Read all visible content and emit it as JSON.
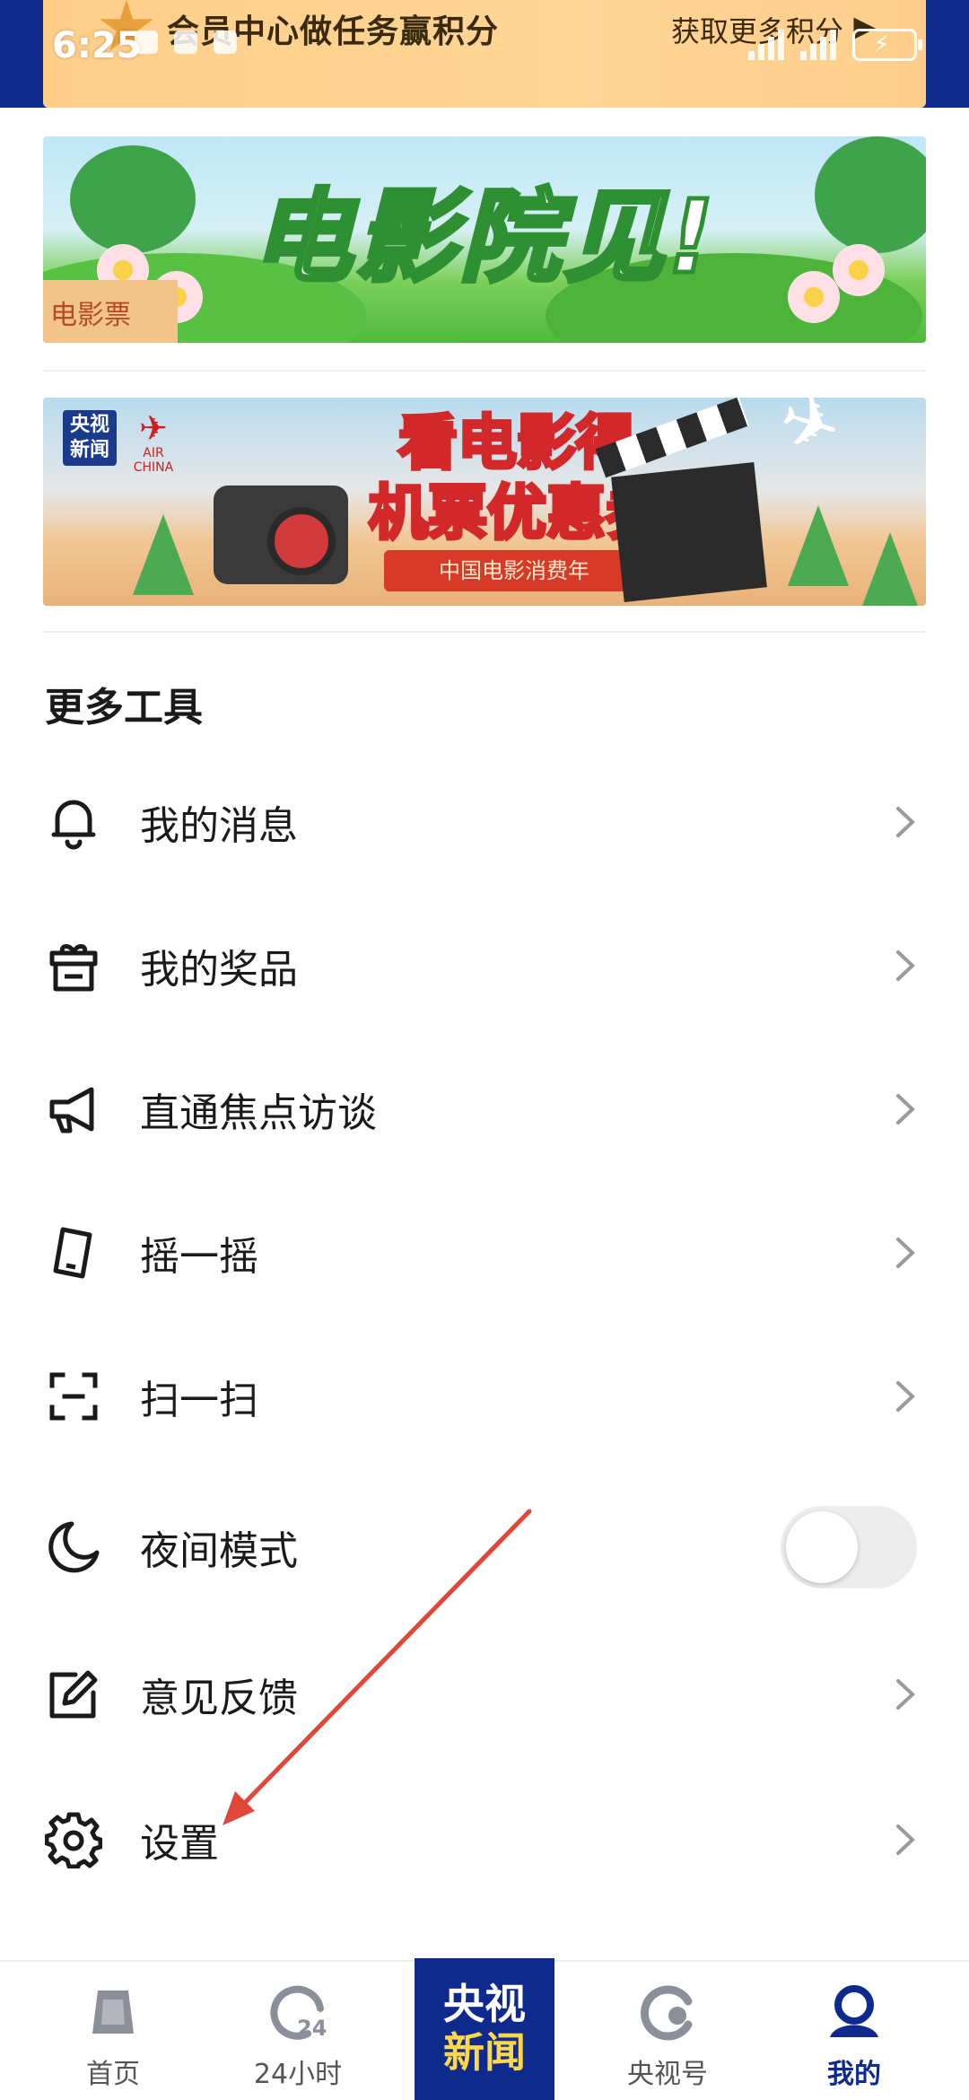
{
  "status_bar": {
    "time": "6:25"
  },
  "task_banner": {
    "title": "会员中心做任务赢积分",
    "link": "获取更多积分",
    "arrow": "▶"
  },
  "banners": {
    "movie": {
      "title": "电影院见!",
      "ticket": "电影票"
    },
    "airchina": {
      "badge": "央视\n新闻",
      "brand": "AIR CHINA",
      "headline_1": "看电影得",
      "headline_2": "机票优惠券",
      "ribbon": "中国电影消费年"
    }
  },
  "section": {
    "title": "更多工具"
  },
  "menu": [
    {
      "label": "我的消息",
      "icon": "bell-icon",
      "control": "chevron"
    },
    {
      "label": "我的奖品",
      "icon": "gift-icon",
      "control": "chevron"
    },
    {
      "label": "直通焦点访谈",
      "icon": "megaphone-icon",
      "control": "chevron"
    },
    {
      "label": "摇一摇",
      "icon": "shake-phone-icon",
      "control": "chevron"
    },
    {
      "label": "扫一扫",
      "icon": "scan-icon",
      "control": "chevron"
    },
    {
      "label": "夜间模式",
      "icon": "moon-icon",
      "control": "toggle",
      "toggle_on": false
    },
    {
      "label": "意见反馈",
      "icon": "edit-icon",
      "control": "chevron"
    },
    {
      "label": "设置",
      "icon": "gear-icon",
      "control": "chevron"
    }
  ],
  "bottom_nav": {
    "home": "首页",
    "hours24": "24小时",
    "hours24_badge": "24",
    "center_1": "央视",
    "center_2": "新闻",
    "yangshihao": "央视号",
    "mine": "我的"
  },
  "colors": {
    "brand_blue": "#0d2a8c",
    "annotation_red": "#e0463a"
  }
}
